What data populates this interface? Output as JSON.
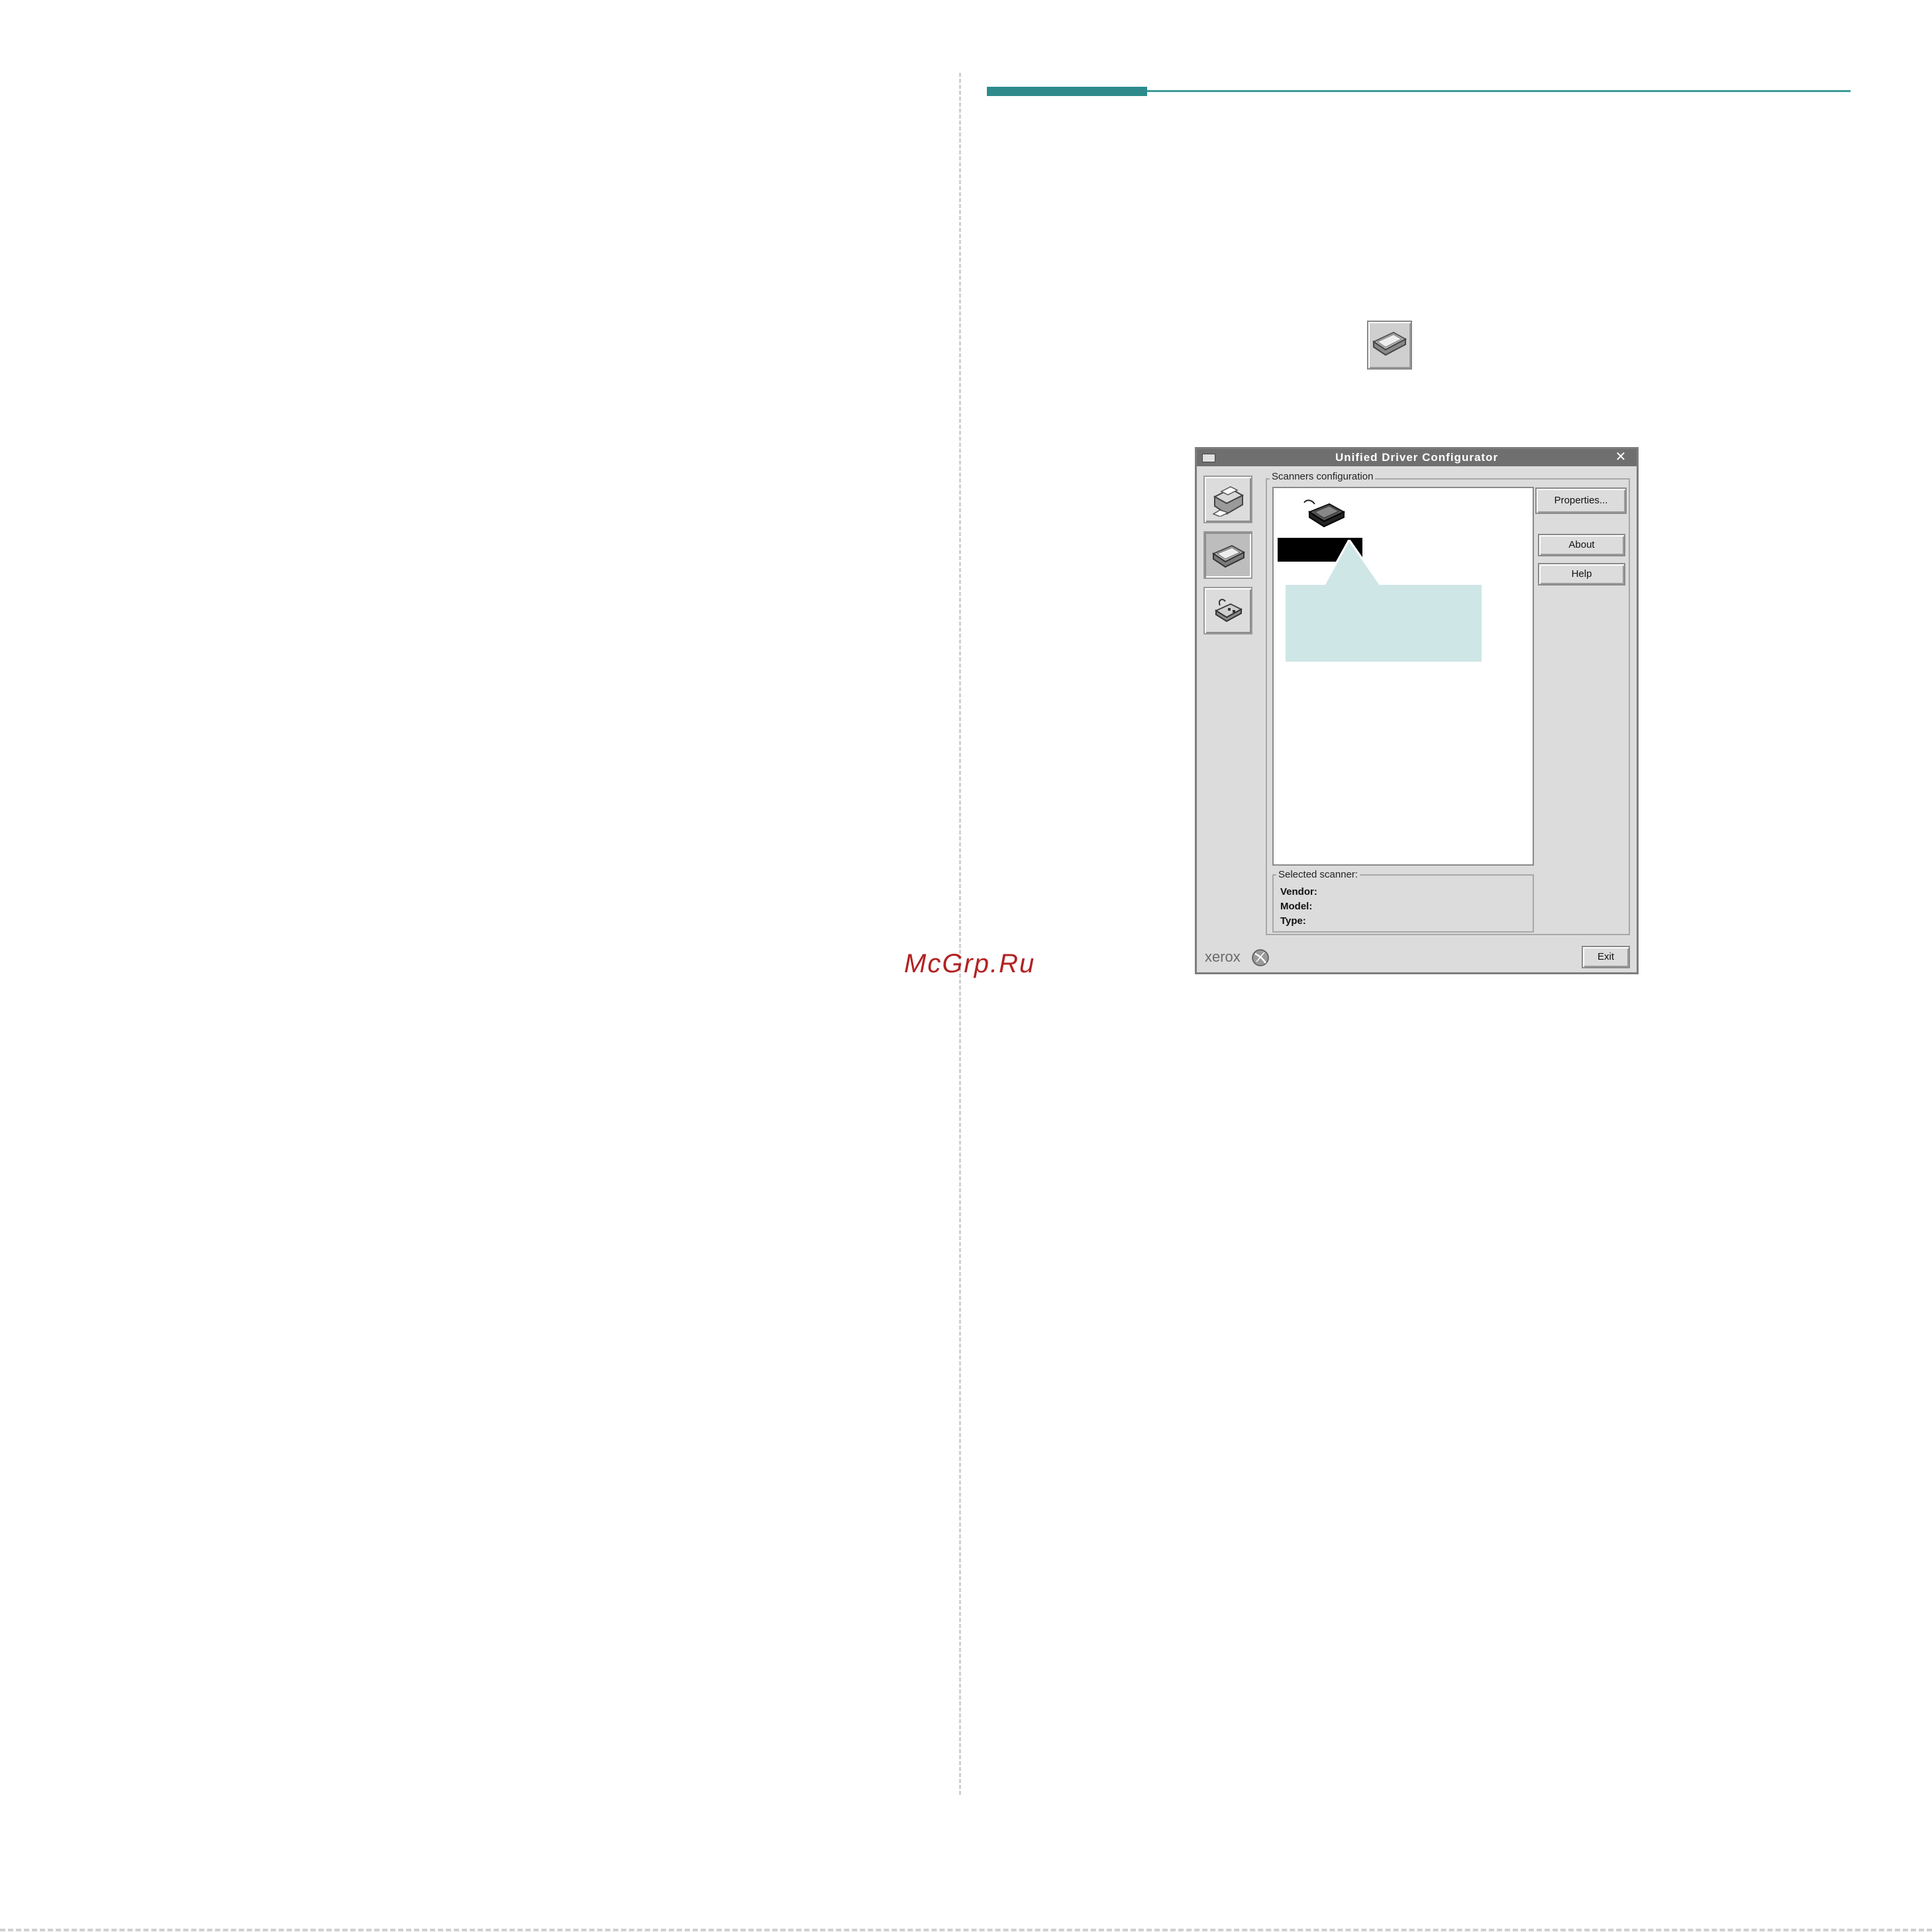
{
  "watermark": "McGrp.Ru",
  "colors": {
    "accent": "#2e8b8b",
    "callout": "#cfe6e6",
    "watermark": "#b22222"
  },
  "inline_icon": "scanner-icon",
  "window": {
    "title": "Unified Driver Configurator",
    "nav": [
      {
        "icon": "printer-icon",
        "active": false
      },
      {
        "icon": "scanner-icon",
        "active": true
      },
      {
        "icon": "port-icon",
        "active": false
      }
    ],
    "config_group_label": "Scanners configuration",
    "buttons": {
      "properties": "Properties...",
      "about": "About",
      "help": "Help",
      "exit": "Exit"
    },
    "selected_scanner": {
      "label": "Selected scanner:",
      "vendor_label": "Vendor:",
      "model_label": "Model:",
      "type_label": "Type:"
    },
    "brand": "xerox"
  }
}
